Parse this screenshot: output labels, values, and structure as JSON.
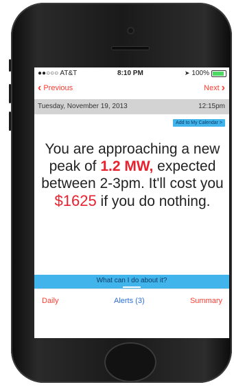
{
  "status_bar": {
    "carrier": "●●○○○ AT&T",
    "time": "8:10 PM",
    "battery": "100%"
  },
  "nav": {
    "previous_label": "Previous",
    "next_label": "Next"
  },
  "date_bar": {
    "date": "Tuesday, November 19, 2013",
    "time": "12:15pm"
  },
  "calendar_button": {
    "label": "Add to My Calendar >"
  },
  "message": {
    "part1": "You are approaching a new peak of ",
    "peak": "1.2 MW,",
    "part2": " expected between 2-3pm. It'll cost you ",
    "cost": "$1625",
    "part3": " if you do nothing."
  },
  "help_bar": {
    "label": "What can I do about it?"
  },
  "tabs": {
    "daily": "Daily",
    "alerts": "Alerts (3)",
    "summary": "Summary"
  },
  "colors": {
    "accent_red": "#e8212e",
    "accent_blue": "#42b4ec",
    "tab_blue": "#2b6ed6"
  }
}
